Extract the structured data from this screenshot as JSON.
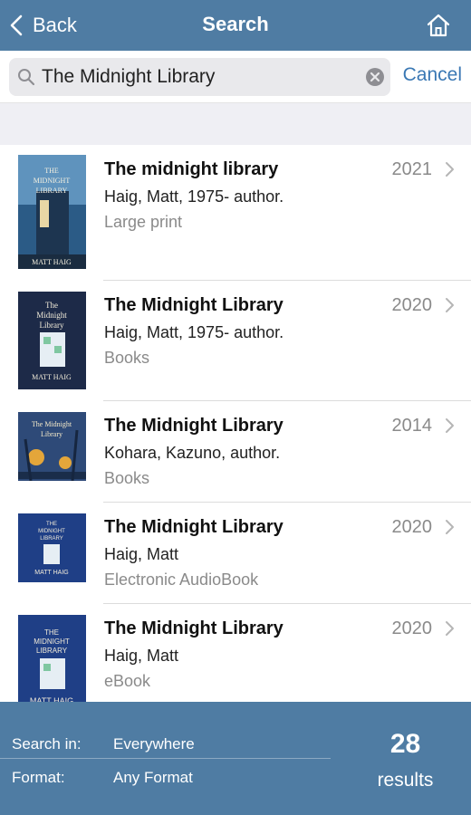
{
  "navbar": {
    "back_label": "Back",
    "title": "Search",
    "home_icon": "home-icon",
    "bg_color": "#4f7ca3"
  },
  "search": {
    "value": "The Midnight Library",
    "placeholder": "Search",
    "cancel_label": "Cancel",
    "search_icon": "search-icon",
    "clear_icon": "clear-icon"
  },
  "results": [
    {
      "title": "The midnight library",
      "author": "Haig, Matt, 1975- author.",
      "format": "Large print",
      "year": "2021",
      "cover_text": "THE MIDNIGHT LIBRARY",
      "cover_author": "MATT HAIG"
    },
    {
      "title": "The Midnight Library",
      "author": "Haig, Matt, 1975- author.",
      "format": "Books",
      "year": "2020",
      "cover_text": "The Midnight Library",
      "cover_author": "MATT HAIG"
    },
    {
      "title": "The Midnight Library",
      "author": "Kohara, Kazuno, author.",
      "format": "Books",
      "year": "2014",
      "cover_text": "The Midnight Library",
      "cover_author": ""
    },
    {
      "title": "The Midnight Library",
      "author": "Haig, Matt",
      "format": "Electronic AudioBook",
      "year": "2020",
      "cover_text": "THE MIDNIGHT LIBRARY",
      "cover_author": "MATT HAIG"
    },
    {
      "title": "The Midnight Library",
      "author": "Haig, Matt",
      "format": "eBook",
      "year": "2020",
      "cover_text": "THE MIDNIGHT LIBRARY",
      "cover_author": "MATT HAIG"
    }
  ],
  "footer": {
    "search_in_label": "Search in:",
    "search_in_value": "Everywhere",
    "format_label": "Format:",
    "format_value": "Any Format",
    "count": "28",
    "results_label": "results"
  }
}
